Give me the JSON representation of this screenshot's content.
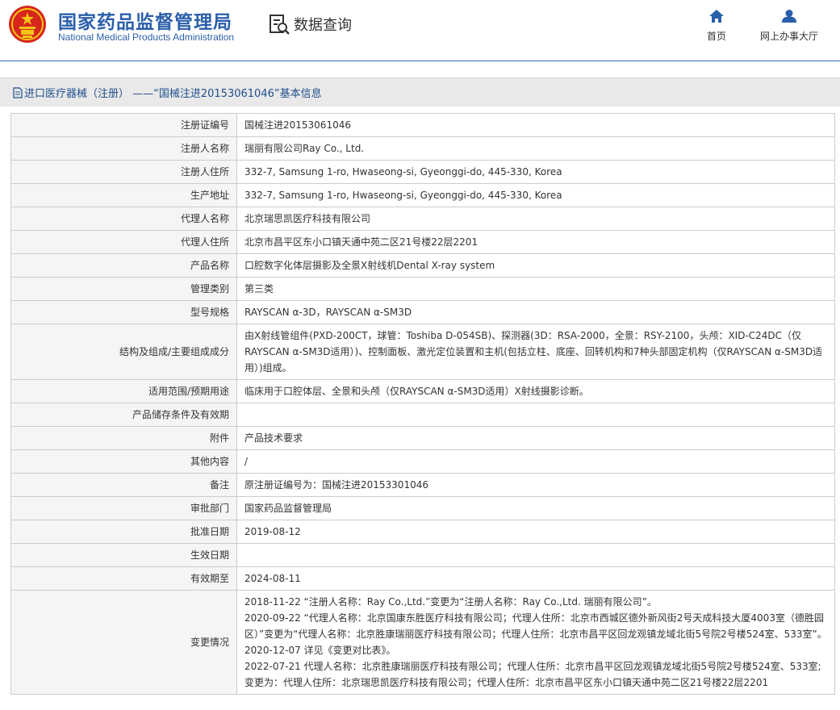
{
  "header": {
    "title": "国家药品监督管理局",
    "subtitle": "National Medical Products Administration",
    "query_label": "数据查询",
    "nav_home": "首页",
    "nav_hall": "网上办事大厅"
  },
  "page": {
    "heading": "进口医疗器械（注册） ——“国械注进20153061046”基本信息"
  },
  "rows": [
    {
      "label": "注册证编号",
      "value": "国械注进20153061046"
    },
    {
      "label": "注册人名称",
      "value": "瑞丽有限公司Ray Co., Ltd."
    },
    {
      "label": "注册人住所",
      "value": "332-7, Samsung 1-ro, Hwaseong-si, Gyeonggi-do, 445-330, Korea"
    },
    {
      "label": "生产地址",
      "value": "332-7, Samsung 1-ro, Hwaseong-si, Gyeonggi-do, 445-330, Korea"
    },
    {
      "label": "代理人名称",
      "value": "北京瑞思凯医疗科技有限公司"
    },
    {
      "label": "代理人住所",
      "value": "北京市昌平区东小口镇天通中苑二区21号楼22层2201"
    },
    {
      "label": "产品名称",
      "value": "口腔数字化体层摄影及全景X射线机Dental X-ray system"
    },
    {
      "label": "管理类别",
      "value": "第三类"
    },
    {
      "label": "型号规格",
      "value": "RAYSCAN α-3D，RAYSCAN α-SM3D"
    },
    {
      "label": "结构及组成/主要组成成分",
      "value": "由X射线管组件(PXD-200CT，球管：Toshiba D-054SB)、探测器(3D：RSA-2000，全景：RSY-2100，头颅：XID-C24DC（仅RAYSCAN α-SM3D适用）)、控制面板、激光定位装置和主机(包括立柱、底座、回转机构和7种头部固定机构（仅RAYSCAN α-SM3D适用）)组成。"
    },
    {
      "label": "适用范围/预期用途",
      "value": "临床用于口腔体层、全景和头颅（仅RAYSCAN α-SM3D适用）X射线摄影诊断。"
    },
    {
      "label": "产品储存条件及有效期",
      "value": ""
    },
    {
      "label": "附件",
      "value": "产品技术要求"
    },
    {
      "label": "其他内容",
      "value": "/"
    },
    {
      "label": "备注",
      "value": "原注册证编号为：国械注进20153301046"
    },
    {
      "label": "审批部门",
      "value": "国家药品监督管理局"
    },
    {
      "label": "批准日期",
      "value": "2019-08-12"
    },
    {
      "label": "生效日期",
      "value": ""
    },
    {
      "label": "有效期至",
      "value": "2024-08-11"
    }
  ],
  "changes": {
    "label": "变更情况",
    "lines": [
      "2018-11-22 “注册人名称：Ray Co.,Ltd.”变更为“注册人名称：Ray Co.,Ltd. 瑞丽有限公司”。",
      "2020-09-22 “代理人名称：北京国康东胜医疗科技有限公司；代理人住所：北京市西城区德外新风街2号天成科技大厦4003室（德胜园区）”变更为“代理人名称：北京胜康瑞丽医疗科技有限公司；代理人住所：北京市昌平区回龙观镇龙域北街5号院2号楼524室、533室”。",
      "2020-12-07 详见《变更对比表》。",
      "2022-07-21 代理人名称：北京胜康瑞丽医疗科技有限公司；代理人住所：北京市昌平区回龙观镇龙域北街5号院2号楼524室、533室;变更为：代理人住所：北京瑞思凯医疗科技有限公司；代理人住所：北京市昌平区东小口镇天通中苑二区21号楼22层2201"
    ]
  },
  "colors": {
    "brand_blue": "#2b5faa",
    "emblem_red": "#d7261b",
    "emblem_gold": "#f5c518"
  }
}
